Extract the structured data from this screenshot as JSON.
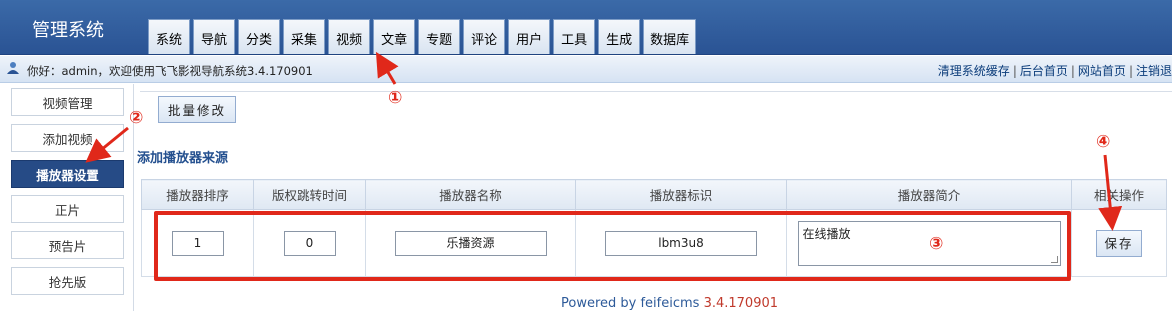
{
  "app": {
    "title": "管理系统"
  },
  "nav": {
    "tabs": [
      "系统",
      "导航",
      "分类",
      "采集",
      "视频",
      "文章",
      "专题",
      "评论",
      "用户",
      "工具",
      "生成",
      "数据库"
    ]
  },
  "infobar": {
    "welcome": "你好：admin，欢迎使用飞飞影视导航系统3.4.170901",
    "links": [
      "清理系统缓存",
      "后台首页",
      "网站首页",
      "注销退"
    ]
  },
  "sidebar": {
    "items": [
      {
        "label": "视频管理"
      },
      {
        "label": "添加视频"
      },
      {
        "label": "播放器设置",
        "active": true
      },
      {
        "label": "正片"
      },
      {
        "label": "预告片"
      },
      {
        "label": "抢先版"
      }
    ]
  },
  "main": {
    "batch_button": "批量修改",
    "section_title": "添加播放器来源",
    "table": {
      "headers": [
        "播放器排序",
        "版权跳转时间",
        "播放器名称",
        "播放器标识",
        "播放器简介",
        "相关操作"
      ],
      "row": {
        "order": "1",
        "jump_time": "0",
        "name": "乐播资源",
        "code": "lbm3u8",
        "description": "在线播放",
        "save_button": "保存"
      }
    }
  },
  "footer": {
    "text": "Powered by feifeicms",
    "version": "3.4.170901"
  },
  "annotations": {
    "marks": [
      "①",
      "②",
      "③",
      "④"
    ],
    "color": "#e0281a"
  }
}
